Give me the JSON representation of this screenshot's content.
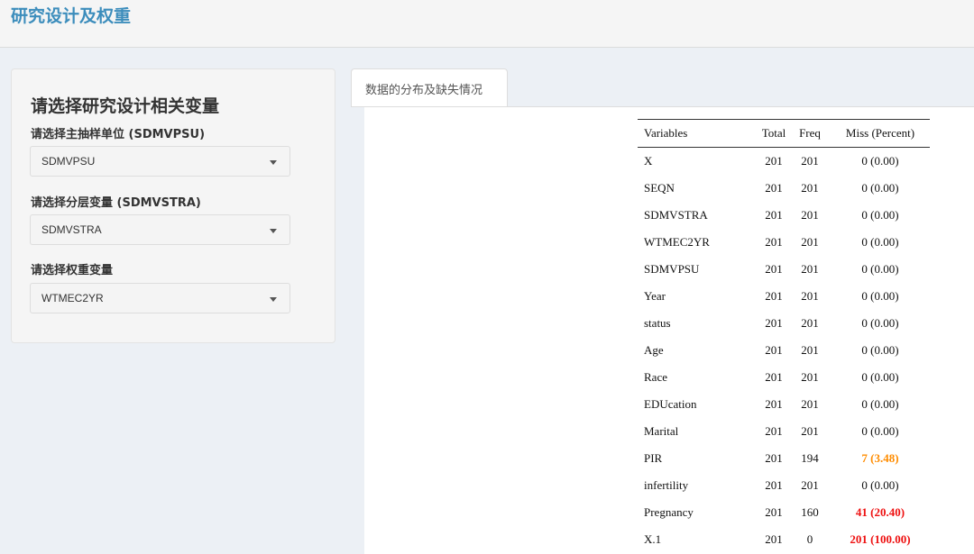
{
  "header": {
    "title": "研究设计及权重"
  },
  "sidebar": {
    "heading": "请选择研究设计相关变量",
    "fields": [
      {
        "label": "请选择主抽样单位 (SDMVPSU)",
        "value": "SDMVPSU"
      },
      {
        "label": "请选择分层变量 (SDMVSTRA)",
        "value": "SDMVSTRA"
      },
      {
        "label": "请选择权重变量",
        "value": "WTMEC2YR"
      }
    ]
  },
  "tabs": [
    {
      "label": "数据的分布及缺失情况",
      "active": true
    }
  ],
  "table": {
    "headers": [
      "Variables",
      "Total",
      "Freq",
      "Miss (Percent)"
    ],
    "rows": [
      {
        "variable": "X",
        "total": "201",
        "freq": "201",
        "miss": "0 (0.00)",
        "level": "none"
      },
      {
        "variable": "SEQN",
        "total": "201",
        "freq": "201",
        "miss": "0 (0.00)",
        "level": "none"
      },
      {
        "variable": "SDMVSTRA",
        "total": "201",
        "freq": "201",
        "miss": "0 (0.00)",
        "level": "none"
      },
      {
        "variable": "WTMEC2YR",
        "total": "201",
        "freq": "201",
        "miss": "0 (0.00)",
        "level": "none"
      },
      {
        "variable": "SDMVPSU",
        "total": "201",
        "freq": "201",
        "miss": "0 (0.00)",
        "level": "none"
      },
      {
        "variable": "Year",
        "total": "201",
        "freq": "201",
        "miss": "0 (0.00)",
        "level": "none"
      },
      {
        "variable": "status",
        "total": "201",
        "freq": "201",
        "miss": "0 (0.00)",
        "level": "none"
      },
      {
        "variable": "Age",
        "total": "201",
        "freq": "201",
        "miss": "0 (0.00)",
        "level": "none"
      },
      {
        "variable": "Race",
        "total": "201",
        "freq": "201",
        "miss": "0 (0.00)",
        "level": "none"
      },
      {
        "variable": "EDUcation",
        "total": "201",
        "freq": "201",
        "miss": "0 (0.00)",
        "level": "none"
      },
      {
        "variable": "Marital",
        "total": "201",
        "freq": "201",
        "miss": "0 (0.00)",
        "level": "none"
      },
      {
        "variable": "PIR",
        "total": "201",
        "freq": "194",
        "miss": "7 (3.48)",
        "level": "warn"
      },
      {
        "variable": "infertility",
        "total": "201",
        "freq": "201",
        "miss": "0 (0.00)",
        "level": "none"
      },
      {
        "variable": "Pregnancy",
        "total": "201",
        "freq": "160",
        "miss": "41 (20.40)",
        "level": "bad"
      },
      {
        "variable": "X.1",
        "total": "201",
        "freq": "0",
        "miss": "201 (100.00)",
        "level": "bad"
      }
    ]
  },
  "colors": {
    "warn": "#ff8c00",
    "bad": "#ee1111",
    "title": "#3c8dbc"
  }
}
